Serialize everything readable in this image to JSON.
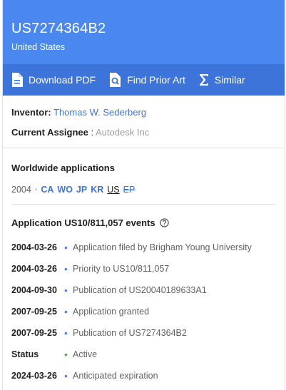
{
  "header": {
    "patent_number": "US7274364B2",
    "country": "United States"
  },
  "actions": [
    {
      "label": "Download PDF",
      "icon": "pdf-icon"
    },
    {
      "label": "Find Prior Art",
      "icon": "search-doc-icon"
    },
    {
      "label": "Similar",
      "icon": "sigma-icon"
    }
  ],
  "meta": {
    "inventor_label": "Inventor:",
    "inventor": "Thomas W. Sederberg",
    "assignee_label": "Current Assignee",
    "assignee_sep": " : ",
    "assignee": "Autodesk Inc"
  },
  "worldwide": {
    "title": "Worldwide applications",
    "year": "2004",
    "countries": [
      "CA",
      "WO",
      "JP",
      "KR",
      "US",
      "EP"
    ]
  },
  "events_section": {
    "title": "Application US10/811,057 events"
  },
  "events": [
    {
      "date": "2004-03-26",
      "desc": "Application filed by Brigham Young University"
    },
    {
      "date": "2004-03-26",
      "desc": "Priority to US10/811,057"
    },
    {
      "date": "2004-09-30",
      "desc": "Publication of US20040189633A1"
    },
    {
      "date": "2007-09-25",
      "desc": "Application granted"
    },
    {
      "date": "2007-09-25",
      "desc": "Publication of US7274364B2"
    },
    {
      "date": "Status",
      "desc": "Active"
    },
    {
      "date": "2024-03-26",
      "desc": "Anticipated expiration"
    }
  ],
  "colors": {
    "header": "#4a88ef",
    "action_bar": "#3c74d9",
    "link": "#3c74d9",
    "status_active": "#4caf50"
  }
}
